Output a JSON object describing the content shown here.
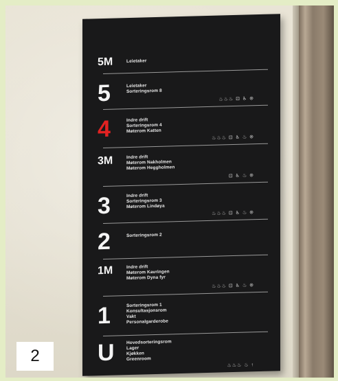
{
  "label": "2",
  "floors": [
    {
      "level": "5M",
      "lines": [
        "Leietaker"
      ],
      "icons": "",
      "highlight": false,
      "small": true
    },
    {
      "level": "5",
      "lines": [
        "Leietaker",
        "Sorteringsrom 8"
      ],
      "icons": "♨♨♨ ⊡ ♿ ⊚",
      "highlight": false,
      "small": false
    },
    {
      "level": "4",
      "lines": [
        "Indre drift",
        "Sorteringsrom 4",
        "Møterom Katten"
      ],
      "icons": "♨♨♨ ⊡ ♿ ♨ ⊚",
      "highlight": true,
      "small": false
    },
    {
      "level": "3M",
      "lines": [
        "Indre drift",
        "Møterom Nakholmen",
        "Møterom Heggholmen"
      ],
      "icons": "⊡ ♿ ♨ ⊚",
      "highlight": false,
      "small": true
    },
    {
      "level": "3",
      "lines": [
        "Indre drift",
        "Sorteringsrom 3",
        "Møterom Lindøya"
      ],
      "icons": "♨♨♨ ⊡ ♿ ♨ ⊚",
      "highlight": false,
      "small": false
    },
    {
      "level": "2",
      "lines": [
        "Sorteringsrom 2"
      ],
      "icons": "",
      "highlight": false,
      "small": false
    },
    {
      "level": "1M",
      "lines": [
        "Indre drift",
        "Møterom Kavringen",
        "Møterom Dyna fyr"
      ],
      "icons": "♨♨♨ ⊡ ♿ ♨ ⊚",
      "highlight": false,
      "small": true
    },
    {
      "level": "1",
      "lines": [
        "Sorteringsrom 1",
        "Konsultasjonsrom",
        "Vakt",
        "Personalgarderobe"
      ],
      "icons": "",
      "highlight": false,
      "small": false
    },
    {
      "level": "U",
      "lines": [
        "Hovedsorteringsrom",
        "Lager",
        "Kjøkken",
        "Greenroom"
      ],
      "icons": "♨♨♨ ♨ ↑",
      "highlight": false,
      "small": false
    }
  ]
}
